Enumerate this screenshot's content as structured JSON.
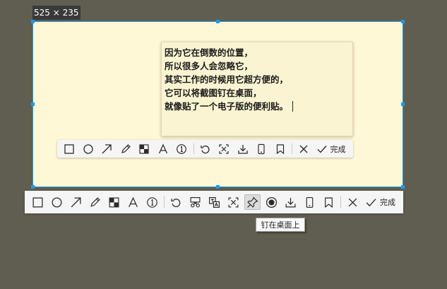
{
  "size_label": "525 × 235",
  "note": {
    "lines": [
      "因为它在倒数的位置，",
      "所以很多人会忽略它，",
      "其实工作的时候用它超方便的，",
      "它可以将截图钉在桌面，",
      "就像贴了一个电子版的便利贴。"
    ]
  },
  "inner_toolbar": {
    "tools": [
      "rectangle-icon",
      "ellipse-icon",
      "arrow-icon",
      "pencil-icon",
      "mosaic-icon",
      "text-icon",
      "number-marker-icon",
      "undo-icon",
      "ocr-icon",
      "download-icon",
      "phone-icon",
      "bookmark-icon",
      "close-icon"
    ],
    "done_label": "完成"
  },
  "outer_toolbar": {
    "tools": [
      "rectangle-icon",
      "ellipse-icon",
      "arrow-icon",
      "pencil-icon",
      "mosaic-icon",
      "text-icon",
      "number-marker-icon",
      "undo-icon",
      "cut-icon",
      "translate-icon",
      "ocr-icon",
      "pin-icon",
      "record-icon",
      "download-icon",
      "phone-icon",
      "bookmark-icon",
      "close-icon"
    ],
    "active_tool": "pin-icon",
    "done_label": "完成"
  },
  "tooltip": "钉在桌面上",
  "colors": {
    "backdrop": "#5f5e50",
    "selection_border": "#1e9be8",
    "selection_fill": "#fff8d6"
  }
}
